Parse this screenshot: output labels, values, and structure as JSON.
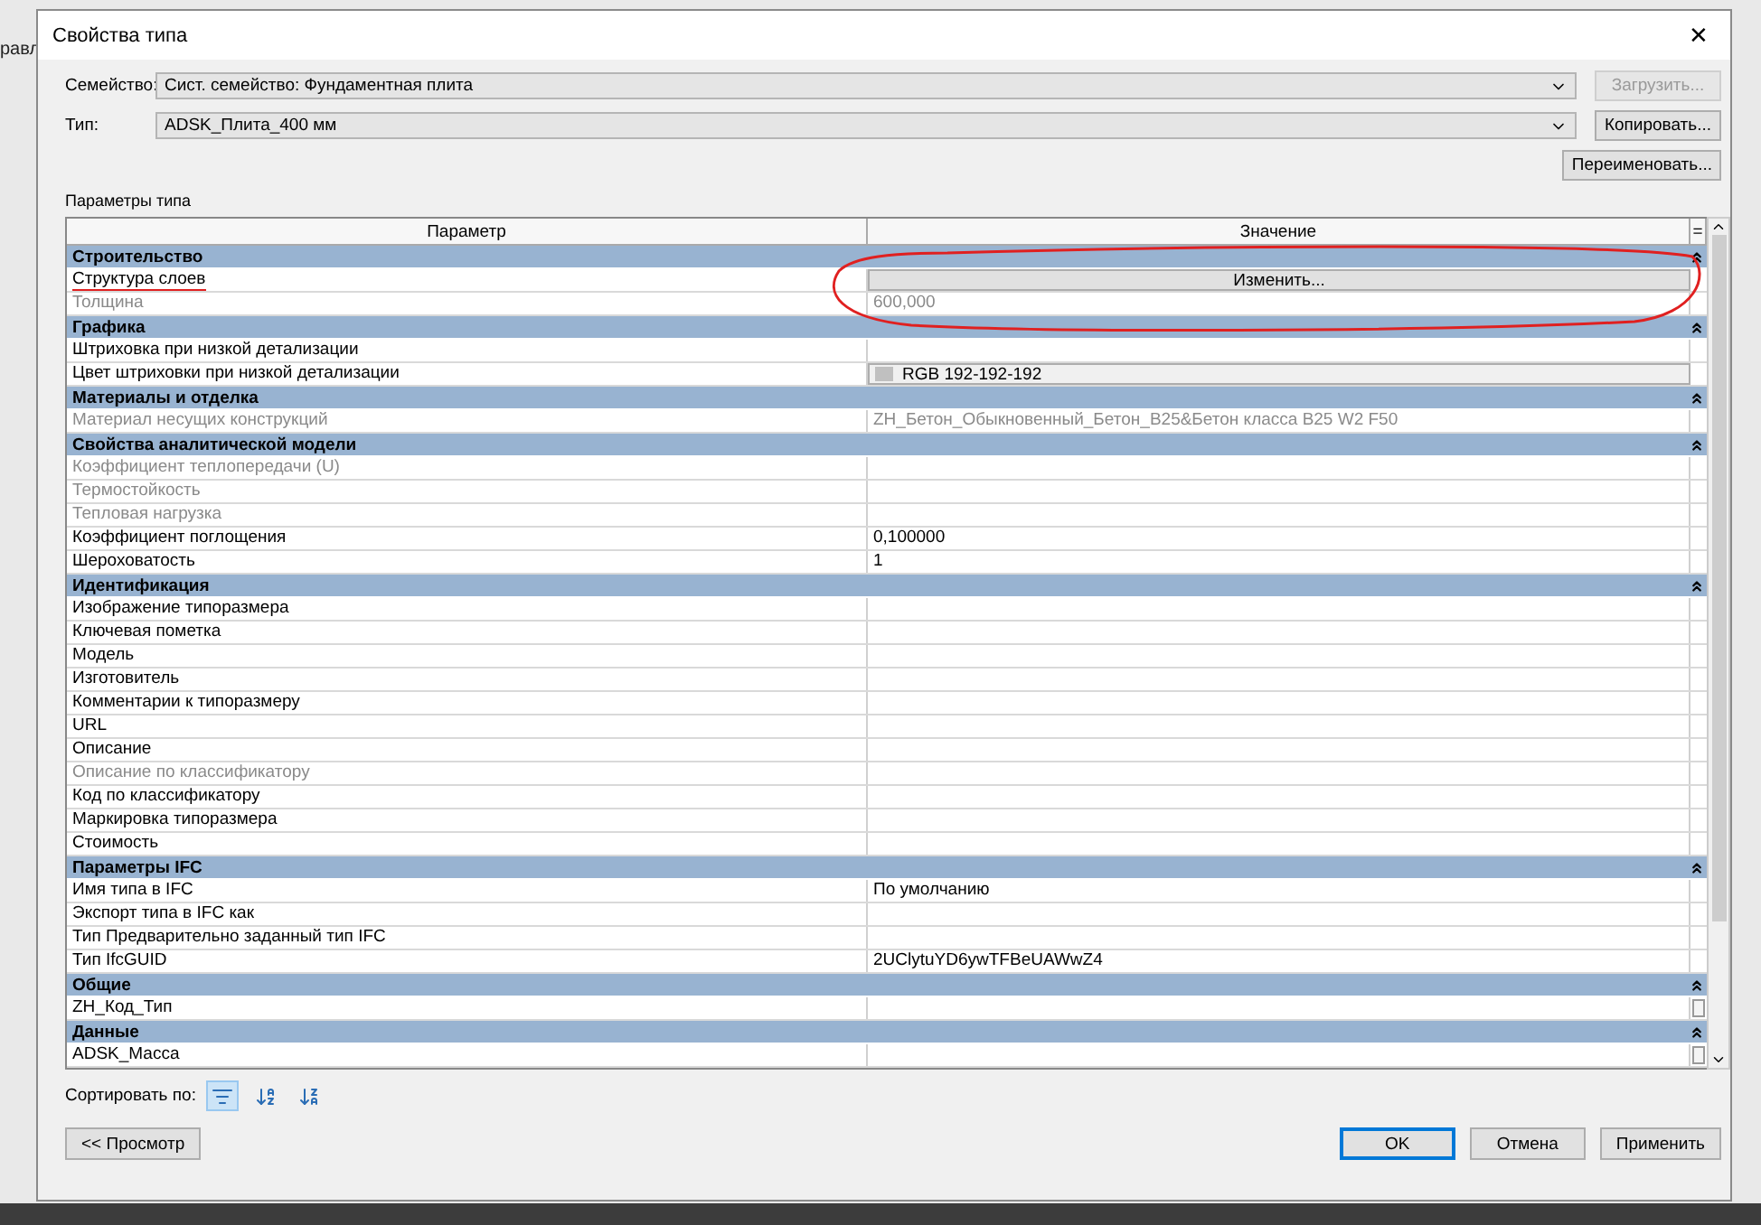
{
  "background_text": "равл",
  "window": {
    "title": "Свойства типа",
    "close": "✕"
  },
  "family": {
    "label": "Семейство:",
    "value": "Сист. семейство: Фундаментная плита"
  },
  "type": {
    "label": "Тип:",
    "value": "ADSK_Плита_400 мм"
  },
  "side_buttons": [
    {
      "label": "Загрузить...",
      "disabled": true
    },
    {
      "label": "Копировать...",
      "disabled": false
    },
    {
      "label": "Переименовать...",
      "disabled": false
    }
  ],
  "params_label": "Параметры типа",
  "table": {
    "columns": [
      "Параметр",
      "Значение",
      "="
    ],
    "sections": [
      {
        "title": "Строительство",
        "rows": [
          {
            "name": "Структура слоев",
            "kind": "button",
            "value": "Изменить...",
            "disabled": false,
            "underlined": true
          },
          {
            "name": "Толщина",
            "kind": "text",
            "value": "600,000",
            "disabled": true
          }
        ]
      },
      {
        "title": "Графика",
        "rows": [
          {
            "name": "Штриховка при низкой детализации",
            "kind": "text",
            "disabled": false
          },
          {
            "name": "Цвет штриховки при низкой детализации",
            "kind": "color",
            "value": "RGB 192-192-192",
            "color": "#c0c0c0",
            "disabled": false
          }
        ]
      },
      {
        "title": "Материалы и отделка",
        "rows": [
          {
            "name": "Материал несущих конструкций",
            "kind": "text",
            "value": "ZH_Бетон_Обыкновенный_Бетон_B25&Бетон класса B25 W2 F50",
            "disabled": true
          }
        ]
      },
      {
        "title": "Свойства аналитической модели",
        "rows": [
          {
            "name": "Коэффициент теплопередачи (U)",
            "kind": "text",
            "disabled": true
          },
          {
            "name": "Термостойкость",
            "kind": "text",
            "disabled": true
          },
          {
            "name": "Тепловая нагрузка",
            "kind": "text",
            "disabled": true
          },
          {
            "name": "Коэффициент поглощения",
            "kind": "text",
            "value": "0,100000",
            "disabled": false
          },
          {
            "name": "Шероховатость",
            "kind": "text",
            "value": "1",
            "disabled": false
          }
        ]
      },
      {
        "title": "Идентификация",
        "rows": [
          {
            "name": "Изображение типоразмера",
            "kind": "text",
            "disabled": false
          },
          {
            "name": "Ключевая пометка",
            "kind": "text",
            "disabled": false
          },
          {
            "name": "Модель",
            "kind": "text",
            "disabled": false
          },
          {
            "name": "Изготовитель",
            "kind": "text",
            "disabled": false
          },
          {
            "name": "Комментарии к типоразмеру",
            "kind": "text",
            "disabled": false
          },
          {
            "name": "URL",
            "kind": "text",
            "disabled": false
          },
          {
            "name": "Описание",
            "kind": "text",
            "disabled": false
          },
          {
            "name": "Описание по классификатору",
            "kind": "text",
            "disabled": true
          },
          {
            "name": "Код по классификатору",
            "kind": "text",
            "disabled": false
          },
          {
            "name": "Маркировка типоразмера",
            "kind": "text",
            "disabled": false
          },
          {
            "name": "Стоимость",
            "kind": "text",
            "disabled": false
          }
        ]
      },
      {
        "title": "Параметры IFC",
        "rows": [
          {
            "name": "Имя типа в IFC",
            "kind": "text",
            "value": "По умолчанию",
            "disabled": false
          },
          {
            "name": "Экспорт типа в IFC как",
            "kind": "text",
            "disabled": false
          },
          {
            "name": "Тип Предварительно заданный тип IFC",
            "kind": "text",
            "disabled": false
          },
          {
            "name": "Тип IfcGUID",
            "kind": "text",
            "value": "2UClytuYD6ywTFBeUAWwZ4",
            "disabled": false
          }
        ]
      },
      {
        "title": "Общие",
        "rows": [
          {
            "name": "ZH_Код_Тип",
            "kind": "checkbox",
            "checked": false,
            "disabled": false
          }
        ]
      },
      {
        "title": "Данные",
        "rows": [
          {
            "name": "ADSK_Масса",
            "kind": "checkbox",
            "checked": false,
            "disabled": false
          }
        ]
      }
    ]
  },
  "markup": [
    {
      "kind": "ellipse"
    }
  ],
  "sort": {
    "label": "Сортировать по:",
    "options": [
      {
        "kind": "group",
        "selected": true
      },
      {
        "kind": "az",
        "selected": false
      },
      {
        "kind": "za",
        "selected": false
      }
    ]
  },
  "preview_button": "<< Просмотр",
  "bottom_buttons": [
    {
      "label": "OK",
      "default": true
    },
    {
      "label": "Отмена",
      "default": false
    },
    {
      "label": "Применить",
      "default": false
    }
  ]
}
